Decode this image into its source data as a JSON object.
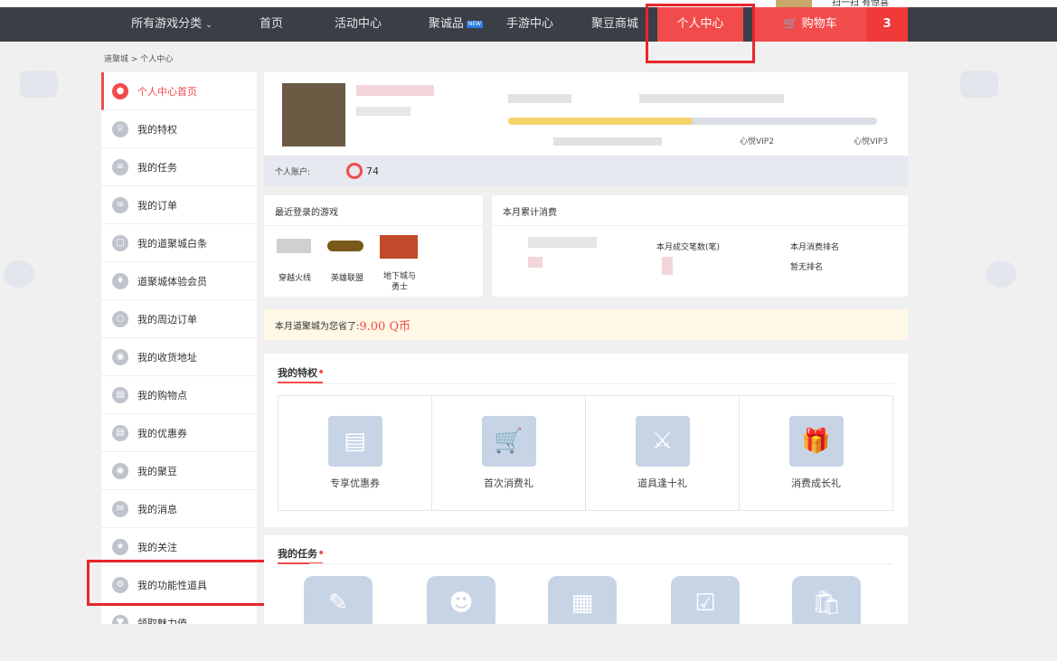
{
  "top": {
    "qr_text": "扫一扫 有惊喜"
  },
  "nav": {
    "categories": "所有游戏分类",
    "home": "首页",
    "events": "活动中心",
    "juchengpin": "聚诚品",
    "new_badge": "NEW",
    "mobile": "手游中心",
    "judou_mall": "聚豆商城",
    "personal": "个人中心",
    "cart": "购物车",
    "cart_count": "3"
  },
  "breadcrumb": "道聚城 > 个人中心",
  "sidebar": {
    "items": [
      {
        "label": "个人中心首页",
        "active": true
      },
      {
        "label": "我的特权"
      },
      {
        "label": "我的任务"
      },
      {
        "label": "我的订单"
      },
      {
        "label": "我的道聚城白条"
      },
      {
        "label": "道聚城体验会员"
      },
      {
        "label": "我的周边订单"
      },
      {
        "label": "我的收货地址"
      },
      {
        "label": "我的购物点"
      },
      {
        "label": "我的优惠券"
      },
      {
        "label": "我的聚豆"
      },
      {
        "label": "我的消息"
      },
      {
        "label": "我的关注"
      },
      {
        "label": "我的功能性道具"
      },
      {
        "label": "领取魅力值"
      }
    ]
  },
  "profile": {
    "vip2": "心悦VIP2",
    "vip3": "心悦VIP3",
    "progress": 0.5,
    "account_label": "个人账户:",
    "account_value": "74"
  },
  "recent_games": {
    "title": "最近登录的游戏",
    "games": [
      "穿越火线",
      "英雄联盟",
      "地下城与勇士"
    ]
  },
  "monthly": {
    "title": "本月累计消费",
    "count_label": "本月成交笔数(笔)",
    "rank_label": "本月消费排名",
    "rank_value": "暂无排名"
  },
  "savings": {
    "text": "本月道聚城为您省了:",
    "amount": "9.00 Q币"
  },
  "privileges": {
    "title": "我的特权",
    "items": [
      "专享优惠券",
      "首次消费礼",
      "道具逢十礼",
      "消费成长礼"
    ]
  },
  "tasks": {
    "title": "我的任务"
  },
  "colors": {
    "accent": "#f24b4b",
    "nav_bg": "#3b3e47"
  }
}
